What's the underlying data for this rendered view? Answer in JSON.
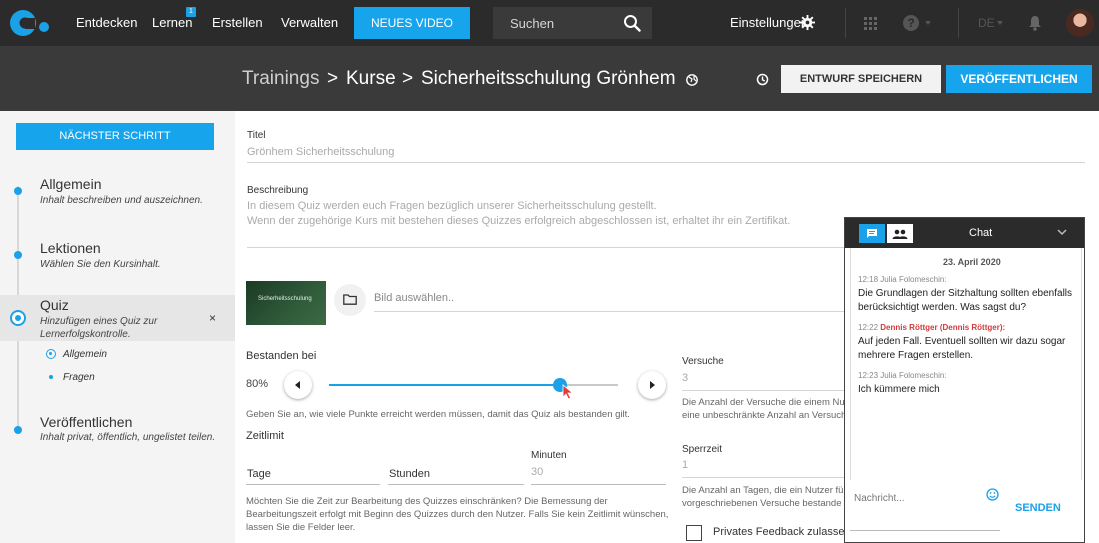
{
  "topbar": {
    "nav": [
      "Entdecken",
      "Lernen",
      "Erstellen",
      "Verwalten"
    ],
    "learn_badge": "1",
    "new_video": "NEUES VIDEO",
    "search_placeholder": "Suchen",
    "settings": "Einstellungen",
    "language": "DE",
    "colors": {
      "bar": "#2b2b2b",
      "accent": "#16a5ec"
    }
  },
  "titlebar": {
    "breadcrumb": [
      "Trainings",
      "Kurse",
      "Sicherheitsschulung Grönhem"
    ],
    "separator": ">",
    "save_draft": "ENTWURF SPEICHERN",
    "publish": "VERÖFFENTLICHEN"
  },
  "sidebar": {
    "next_step": "NÄCHSTER SCHRITT",
    "steps": [
      {
        "title": "Allgemein",
        "desc": "Inhalt beschreiben und auszeichnen."
      },
      {
        "title": "Lektionen",
        "desc": "Wählen Sie den Kursinhalt."
      },
      {
        "title": "Quiz",
        "desc": "Hinzufügen eines Quiz zur Lernerfolgskontrolle."
      },
      {
        "title": "Veröffentlichen",
        "desc": "Inhalt privat, öffentlich, ungelistet teilen."
      }
    ],
    "substeps": [
      "Allgemein",
      "Fragen"
    ],
    "close": "×"
  },
  "form": {
    "title_label": "Titel",
    "title_value": "Grönhem Sicherheitsschulung",
    "desc_label": "Beschreibung",
    "desc_line1": "In diesem Quiz werden euch Fragen bezüglich unserer Sicherheitsschulung gestellt.",
    "desc_line2": "Wenn der zugehörige Kurs mit bestehen dieses Quizzes erfolgreich abgeschlossen ist, erhaltet ihr ein Zertifikat.",
    "thumb_text": "Sicherheitsschulung",
    "image_pick": "Bild auswählen..",
    "passed_label": "Bestanden bei",
    "passed_value": "80%",
    "passed_fraction": 0.8,
    "passed_help": "Geben Sie an, wie viele Punkte erreicht werden müssen, damit das Quiz als bestanden gilt.",
    "time_limit_label": "Zeitlimit",
    "days_label": "Tage",
    "hours_label": "Stunden",
    "minutes_label": "Minuten",
    "minutes_value": "30",
    "time_help_1": "Möchten Sie die Zeit zur Bearbeitung des Quizzes einschränken? Die Bemessung der",
    "time_help_2": "Bearbeitungszeit erfolgt mit Beginn des Quizzes durch den Nutzer. Falls Sie kein Zeitlimit wünschen,",
    "time_help_3": "lassen Sie die Felder leer.",
    "attempts_label": "Versuche",
    "attempts_value": "3",
    "attempts_help_1": "Die Anzahl der Versuche die einem Nutz",
    "attempts_help_2": "eine unbeschränkte Anzahl an Versuch",
    "lock_label": "Sperrzeit",
    "lock_value": "1",
    "lock_help_1": "Die Anzahl an Tagen, die ein Nutzer für",
    "lock_help_2": "vorgeschriebenen Versuche bestande",
    "private_feedback": "Privates Feedback zulasse"
  },
  "chat": {
    "title": "Chat",
    "date": "23. April 2020",
    "messages": [
      {
        "time": "12:18",
        "author": "Julia Folomeschin:",
        "text1": "Die Grundlagen der Sitzhaltung sollten ebenfalls",
        "text2": "berücksichtigt werden. Was sagst du?"
      },
      {
        "time": "12:22",
        "author": "Dennis Röttger (Dennis Röttger):",
        "text1": "Auf jeden Fall. Eventuell sollten wir dazu sogar",
        "text2": "mehrere Fragen erstellen."
      },
      {
        "time": "12:23",
        "author": "Julia Folomeschin:",
        "text1": "Ich kümmere mich",
        "text2": ""
      }
    ],
    "input_placeholder": "Nachricht...",
    "send": "SENDEN"
  }
}
